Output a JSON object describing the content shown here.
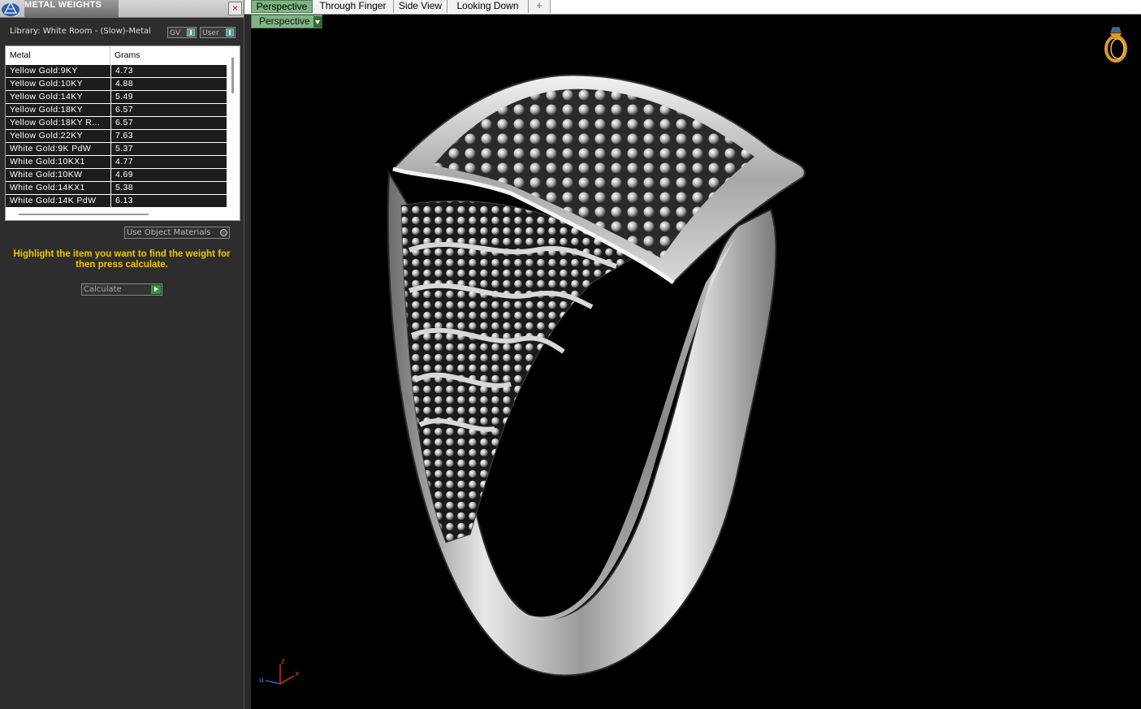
{
  "panel": {
    "title": "METAL WEIGHTS",
    "close_glyph": "×",
    "library_label": "Library: White Room - (Slow)-Metal",
    "toggle_gv": "GV",
    "toggle_user": "User",
    "table": {
      "headers": {
        "metal": "Metal",
        "grams": "Grams"
      },
      "rows": [
        {
          "metal": "Yellow Gold:9KY",
          "grams": "4.73"
        },
        {
          "metal": "Yellow Gold:10KY",
          "grams": "4.88"
        },
        {
          "metal": "Yellow Gold:14KY",
          "grams": "5.49"
        },
        {
          "metal": "Yellow Gold:18KY",
          "grams": "6.57"
        },
        {
          "metal": "Yellow Gold:18KY R...",
          "grams": "6.57"
        },
        {
          "metal": "Yellow Gold:22KY",
          "grams": "7.63"
        },
        {
          "metal": "White Gold:9K PdW",
          "grams": "5.37"
        },
        {
          "metal": "White Gold:10KX1",
          "grams": "4.77"
        },
        {
          "metal": "White Gold:10KW",
          "grams": "4.69"
        },
        {
          "metal": "White Gold:14KX1",
          "grams": "5.38"
        },
        {
          "metal": "White Gold:14K PdW",
          "grams": "6.13"
        }
      ]
    },
    "use_object_materials": "Use Object Materials",
    "instructions": "Highlight the item you want to find the weight for then press calculate.",
    "calculate_label": "Calculate"
  },
  "tabs": [
    {
      "label": "Perspective",
      "active": true
    },
    {
      "label": "Through Finger",
      "active": false
    },
    {
      "label": "Side View",
      "active": false
    },
    {
      "label": "Looking Down",
      "active": false
    }
  ],
  "tab_add_glyph": "+",
  "viewport": {
    "view_label": "Perspective",
    "axis_labels": {
      "x": "x",
      "y": "u",
      "z": "z"
    }
  },
  "icons": {
    "app_logo": "rhino-logo-icon",
    "ring_icon": "ring-icon",
    "add": "plus-icon"
  },
  "colors": {
    "active_tab": "#7fb383",
    "instructions": "#f5c400",
    "calculate_go": "#2c9a3a"
  }
}
